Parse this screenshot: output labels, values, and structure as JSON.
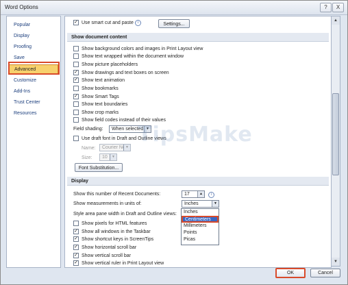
{
  "window": {
    "title": "Word Options",
    "help_glyph": "?",
    "close_glyph": "X"
  },
  "sidebar": {
    "items": [
      {
        "label": "Popular"
      },
      {
        "label": "Display"
      },
      {
        "label": "Proofing"
      },
      {
        "label": "Save"
      },
      {
        "label": "Advanced"
      },
      {
        "label": "Customize"
      },
      {
        "label": "Add-Ins"
      },
      {
        "label": "Trust Center"
      },
      {
        "label": "Resources"
      }
    ],
    "active": "Advanced"
  },
  "top_row": {
    "label": "Use smart cut and paste",
    "settings_button": "Settings..."
  },
  "show_document_content": {
    "header": "Show document content",
    "options": [
      {
        "label": "Show background colors and images in Print Layout view",
        "checked": false
      },
      {
        "label": "Show text wrapped within the document window",
        "checked": false
      },
      {
        "label": "Show picture placeholders",
        "checked": false
      },
      {
        "label": "Show drawings and text boxes on screen",
        "checked": true
      },
      {
        "label": "Show text animation",
        "checked": true
      },
      {
        "label": "Show bookmarks",
        "checked": false
      },
      {
        "label": "Show Smart Tags",
        "checked": true
      },
      {
        "label": "Show text boundaries",
        "checked": false
      },
      {
        "label": "Show crop marks",
        "checked": false
      },
      {
        "label": "Show field codes instead of their values",
        "checked": false
      }
    ],
    "field_shading_label": "Field shading:",
    "field_shading_value": "When selected",
    "draft_font_label": "Use draft font in Draft and Outline views",
    "name_label": "Name:",
    "name_value": "Courier New",
    "size_label": "Size:",
    "size_value": "10",
    "font_substitution_button": "Font Substitution..."
  },
  "display": {
    "header": "Display",
    "recent_docs_label": "Show this number of Recent Documents:",
    "recent_docs_value": "17",
    "units_label": "Show measurements in units of:",
    "units_value": "Inches",
    "style_area_label": "Style area pane width in Draft and Outline views:",
    "units_options": [
      "Inches",
      "Centimeters",
      "Millimeters",
      "Points",
      "Picas"
    ],
    "units_highlighted": "Centimeters",
    "options": [
      {
        "label": "Show pixels for HTML features",
        "checked": false
      },
      {
        "label": "Show all windows in the Taskbar",
        "checked": true
      },
      {
        "label": "Show shortcut keys in ScreenTips",
        "checked": true
      },
      {
        "label": "Show horizontal scroll bar",
        "checked": true
      },
      {
        "label": "Show vertical scroll bar",
        "checked": true
      },
      {
        "label": "Show vertical ruler in Print Layout view",
        "checked": true
      }
    ]
  },
  "footer": {
    "ok": "OK",
    "cancel": "Cancel"
  },
  "watermark": "TipsMake",
  "colors": {
    "active_nav": "#f7d16d",
    "highlight_border": "#d94a2a",
    "selection": "#3767c4"
  },
  "icons": {
    "info": "info-icon",
    "dropdown": "chevron-down-icon"
  }
}
